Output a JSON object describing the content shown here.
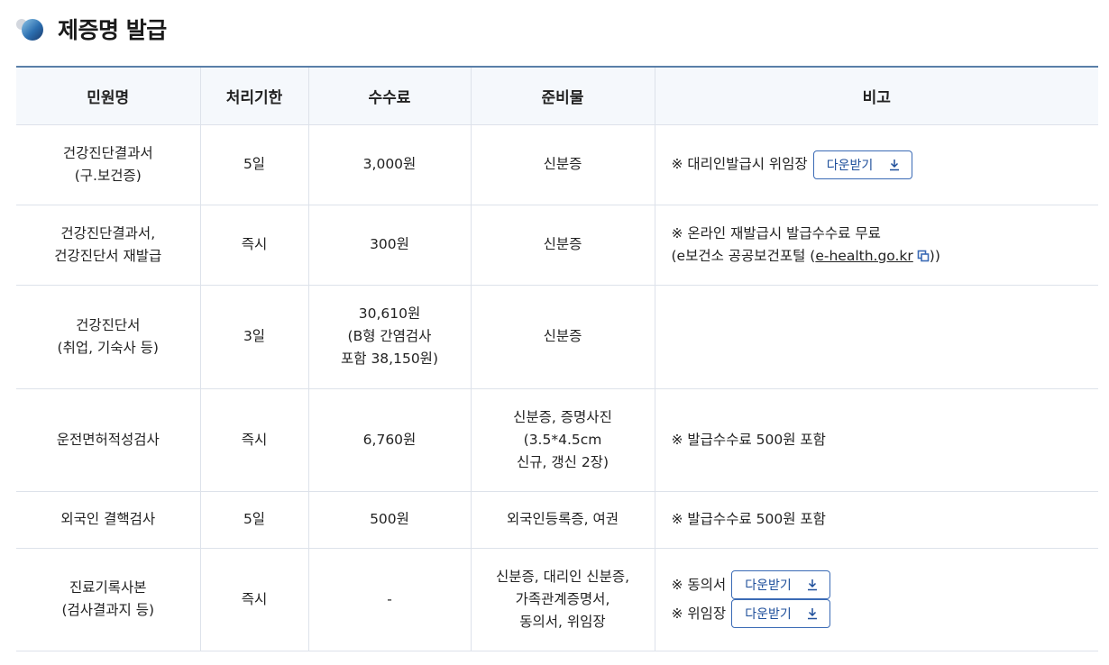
{
  "section": {
    "title": "제증명 발급"
  },
  "table": {
    "headers": [
      "민원명",
      "처리기한",
      "수수료",
      "준비물",
      "비고"
    ],
    "rows": [
      {
        "name": [
          "건강진단결과서",
          "(구.보건증)"
        ],
        "period": "5일",
        "fee": [
          "3,000원"
        ],
        "prep": [
          "신분증"
        ],
        "note": {
          "text": "※ 대리인발급시 위임장",
          "button": "다운받기"
        }
      },
      {
        "name": [
          "건강진단결과서,",
          "건강진단서 재발급"
        ],
        "period": "즉시",
        "fee": [
          "300원"
        ],
        "prep": [
          "신분증"
        ],
        "note": {
          "line1": "※ 온라인 재발급시 발급수수료 무료",
          "line2_prefix": "(e보건소 공공보건포털 (",
          "link": "e-health.go.kr",
          "line2_suffix": "))"
        }
      },
      {
        "name": [
          "건강진단서",
          "(취업, 기숙사 등)"
        ],
        "period": "3일",
        "fee": [
          "30,610원",
          "(B형 간염검사",
          "포함 38,150원)"
        ],
        "prep": [
          "신분증"
        ],
        "note": {}
      },
      {
        "name": [
          "운전면허적성검사"
        ],
        "period": "즉시",
        "fee": [
          "6,760원"
        ],
        "prep": [
          "신분증, 증명사진",
          "(3.5*4.5cm",
          "신규, 갱신 2장)"
        ],
        "note": {
          "text": "※ 발급수수료 500원 포함"
        }
      },
      {
        "name": [
          "외국인 결핵검사"
        ],
        "period": "5일",
        "fee": [
          "500원"
        ],
        "prep": [
          "외국인등록증, 여권"
        ],
        "note": {
          "text": "※ 발급수수료 500원 포함"
        }
      },
      {
        "name": [
          "진료기록사본",
          "(검사결과지 등)"
        ],
        "period": "즉시",
        "fee": [
          "-"
        ],
        "prep": [
          "신분증, 대리인 신분증,",
          "가족관계증명서,",
          "동의서, 위임장"
        ],
        "note": {
          "items": [
            {
              "text": "※ 동의서",
              "button": "다운받기"
            },
            {
              "text": "※ 위임장",
              "button": "다운받기"
            }
          ]
        }
      }
    ]
  },
  "colors": {
    "header_bg": "#f5f8fc",
    "accent": "#3a6ab5",
    "border_top": "#5a7fa8"
  },
  "icons": {
    "download": "download-icon",
    "external": "external-link-icon",
    "bullet": "title-bullet-icon"
  }
}
